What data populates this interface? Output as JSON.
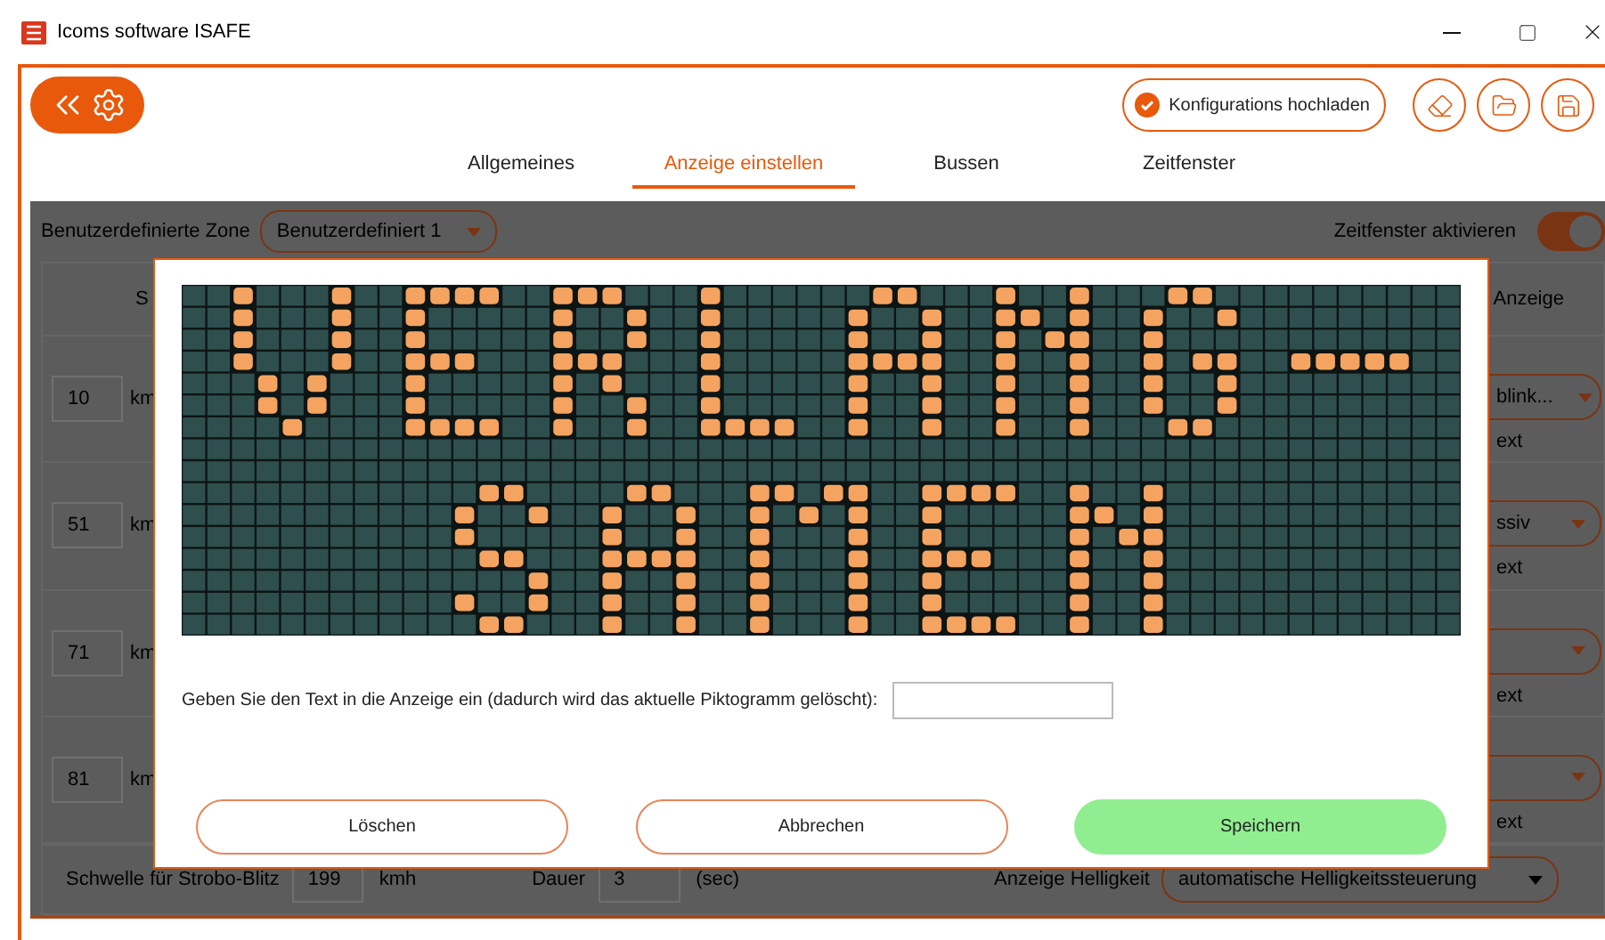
{
  "window": {
    "title": "Icoms software ISAFE"
  },
  "toolbar": {
    "upload_button": "Konfigurations hochladen"
  },
  "tabs": [
    {
      "label": "Allgemeines",
      "selected": false
    },
    {
      "label": "Anzeige einstellen",
      "selected": true
    },
    {
      "label": "Bussen",
      "selected": false
    },
    {
      "label": "Zeitfenster",
      "selected": false
    }
  ],
  "zone": {
    "label": "Benutzerdefinierte Zone",
    "value": "Benutzerdefiniert 1"
  },
  "time_window": {
    "label": "Zeitfenster aktivieren",
    "on": true
  },
  "table": {
    "column_1": "S",
    "column_2": "Anzeige",
    "rows": [
      {
        "speed": "10",
        "unit": "km",
        "display": "blink...",
        "note": "ext"
      },
      {
        "speed": "51",
        "unit": "km",
        "display": "ssiv",
        "note": "ext"
      },
      {
        "speed": "71",
        "unit": "km",
        "note": "ext"
      },
      {
        "speed": "81",
        "unit": "km",
        "note": "ext"
      }
    ]
  },
  "strobe": {
    "label": "Schwelle für Strobo-Blitz",
    "value": "199",
    "unit": "kmh",
    "duration_label": "Dauer",
    "duration": "3",
    "duration_unit": "(sec)",
    "brightness_label": "Anzeige Helligkeit",
    "brightness": "automatische Helligkeitssteuerung"
  },
  "dialog": {
    "matrix": {
      "rows": [
        {
          "lit": [
            false,
            false,
            true,
            false,
            false,
            false,
            true,
            false,
            false,
            true,
            true,
            true,
            true,
            false,
            false,
            true,
            true,
            true,
            false,
            false,
            false,
            true,
            false,
            false,
            false,
            false,
            false,
            false,
            true,
            true,
            false,
            false,
            false,
            true,
            false,
            false,
            true,
            false,
            false,
            false,
            true,
            true,
            false,
            false,
            false,
            false,
            false,
            false,
            false,
            false,
            false,
            false
          ]
        },
        {
          "lit": [
            false,
            false,
            true,
            false,
            false,
            false,
            true,
            false,
            false,
            true,
            false,
            false,
            false,
            false,
            false,
            true,
            false,
            false,
            true,
            false,
            false,
            true,
            false,
            false,
            false,
            false,
            false,
            true,
            false,
            false,
            true,
            false,
            false,
            true,
            true,
            false,
            true,
            false,
            false,
            true,
            false,
            false,
            true,
            false,
            false,
            false,
            false,
            false,
            false,
            false,
            false,
            false
          ]
        },
        {
          "lit": [
            false,
            false,
            true,
            false,
            false,
            false,
            true,
            false,
            false,
            true,
            false,
            false,
            false,
            false,
            false,
            true,
            false,
            false,
            true,
            false,
            false,
            true,
            false,
            false,
            false,
            false,
            false,
            true,
            false,
            false,
            true,
            false,
            false,
            true,
            false,
            true,
            true,
            false,
            false,
            true,
            false,
            false,
            false,
            false,
            false,
            false,
            false,
            false,
            false,
            false,
            false,
            false
          ]
        },
        {
          "lit": [
            false,
            false,
            true,
            false,
            false,
            false,
            true,
            false,
            false,
            true,
            true,
            true,
            false,
            false,
            false,
            true,
            true,
            true,
            false,
            false,
            false,
            true,
            false,
            false,
            false,
            false,
            false,
            true,
            true,
            true,
            true,
            false,
            false,
            true,
            false,
            false,
            true,
            false,
            false,
            true,
            false,
            true,
            true,
            false,
            false,
            true,
            true,
            true,
            true,
            true,
            false,
            false
          ]
        },
        {
          "lit": [
            false,
            false,
            false,
            true,
            false,
            true,
            false,
            false,
            false,
            true,
            false,
            false,
            false,
            false,
            false,
            true,
            false,
            true,
            false,
            false,
            false,
            true,
            false,
            false,
            false,
            false,
            false,
            true,
            false,
            false,
            true,
            false,
            false,
            true,
            false,
            false,
            true,
            false,
            false,
            true,
            false,
            false,
            true,
            false,
            false,
            false,
            false,
            false,
            false,
            false,
            false,
            false
          ]
        },
        {
          "lit": [
            false,
            false,
            false,
            true,
            false,
            true,
            false,
            false,
            false,
            true,
            false,
            false,
            false,
            false,
            false,
            true,
            false,
            false,
            true,
            false,
            false,
            true,
            false,
            false,
            false,
            false,
            false,
            true,
            false,
            false,
            true,
            false,
            false,
            true,
            false,
            false,
            true,
            false,
            false,
            true,
            false,
            false,
            true,
            false,
            false,
            false,
            false,
            false,
            false,
            false,
            false,
            false
          ]
        },
        {
          "lit": [
            false,
            false,
            false,
            false,
            true,
            false,
            false,
            false,
            false,
            true,
            true,
            true,
            true,
            false,
            false,
            true,
            false,
            false,
            true,
            false,
            false,
            true,
            true,
            true,
            true,
            false,
            false,
            true,
            false,
            false,
            true,
            false,
            false,
            true,
            false,
            false,
            true,
            false,
            false,
            false,
            true,
            true,
            false,
            false,
            false,
            false,
            false,
            false,
            false,
            false,
            false,
            false
          ]
        },
        {
          "lit": [
            false,
            false,
            false,
            false,
            false,
            false,
            false,
            false,
            false,
            false,
            false,
            false,
            false,
            false,
            false,
            false,
            false,
            false,
            false,
            false,
            false,
            false,
            false,
            false,
            false,
            false,
            false,
            false,
            false,
            false,
            false,
            false,
            false,
            false,
            false,
            false,
            false,
            false,
            false,
            false,
            false,
            false,
            false,
            false,
            false,
            false,
            false,
            false,
            false,
            false,
            false,
            false
          ]
        },
        {
          "lit": [
            false,
            false,
            false,
            false,
            false,
            false,
            false,
            false,
            false,
            false,
            false,
            false,
            false,
            false,
            false,
            false,
            false,
            false,
            false,
            false,
            false,
            false,
            false,
            false,
            false,
            false,
            false,
            false,
            false,
            false,
            false,
            false,
            false,
            false,
            false,
            false,
            false,
            false,
            false,
            false,
            false,
            false,
            false,
            false,
            false,
            false,
            false,
            false,
            false,
            false,
            false,
            false
          ]
        },
        {
          "lit": [
            false,
            false,
            false,
            false,
            false,
            false,
            false,
            false,
            false,
            false,
            false,
            false,
            true,
            true,
            false,
            false,
            false,
            false,
            true,
            true,
            false,
            false,
            false,
            true,
            true,
            false,
            true,
            true,
            false,
            false,
            true,
            true,
            true,
            true,
            false,
            false,
            true,
            false,
            false,
            true,
            false,
            false,
            false,
            false,
            false,
            false,
            false,
            false,
            false,
            false,
            false,
            false
          ]
        },
        {
          "lit": [
            false,
            false,
            false,
            false,
            false,
            false,
            false,
            false,
            false,
            false,
            false,
            true,
            false,
            false,
            true,
            false,
            false,
            true,
            false,
            false,
            true,
            false,
            false,
            true,
            false,
            true,
            false,
            true,
            false,
            false,
            true,
            false,
            false,
            false,
            false,
            false,
            true,
            true,
            false,
            true,
            false,
            false,
            false,
            false,
            false,
            false,
            false,
            false,
            false,
            false,
            false,
            false
          ]
        },
        {
          "lit": [
            false,
            false,
            false,
            false,
            false,
            false,
            false,
            false,
            false,
            false,
            false,
            true,
            false,
            false,
            false,
            false,
            false,
            true,
            false,
            false,
            true,
            false,
            false,
            true,
            false,
            false,
            false,
            true,
            false,
            false,
            true,
            false,
            false,
            false,
            false,
            false,
            true,
            false,
            true,
            true,
            false,
            false,
            false,
            false,
            false,
            false,
            false,
            false,
            false,
            false,
            false,
            false
          ]
        },
        {
          "lit": [
            false,
            false,
            false,
            false,
            false,
            false,
            false,
            false,
            false,
            false,
            false,
            false,
            true,
            true,
            false,
            false,
            false,
            true,
            true,
            true,
            true,
            false,
            false,
            true,
            false,
            false,
            false,
            true,
            false,
            false,
            true,
            true,
            true,
            false,
            false,
            false,
            true,
            false,
            false,
            true,
            false,
            false,
            false,
            false,
            false,
            false,
            false,
            false,
            false,
            false,
            false,
            false
          ]
        },
        {
          "lit": [
            false,
            false,
            false,
            false,
            false,
            false,
            false,
            false,
            false,
            false,
            false,
            false,
            false,
            false,
            true,
            false,
            false,
            true,
            false,
            false,
            true,
            false,
            false,
            true,
            false,
            false,
            false,
            true,
            false,
            false,
            true,
            false,
            false,
            false,
            false,
            false,
            true,
            false,
            false,
            true,
            false,
            false,
            false,
            false,
            false,
            false,
            false,
            false,
            false,
            false,
            false,
            false
          ]
        },
        {
          "lit": [
            false,
            false,
            false,
            false,
            false,
            false,
            false,
            false,
            false,
            false,
            false,
            true,
            false,
            false,
            true,
            false,
            false,
            true,
            false,
            false,
            true,
            false,
            false,
            true,
            false,
            false,
            false,
            true,
            false,
            false,
            true,
            false,
            false,
            false,
            false,
            false,
            true,
            false,
            false,
            true,
            false,
            false,
            false,
            false,
            false,
            false,
            false,
            false,
            false,
            false,
            false,
            false
          ]
        },
        {
          "lit": [
            false,
            false,
            false,
            false,
            false,
            false,
            false,
            false,
            false,
            false,
            false,
            false,
            true,
            true,
            false,
            false,
            false,
            true,
            false,
            false,
            true,
            false,
            false,
            true,
            false,
            false,
            false,
            true,
            false,
            false,
            true,
            true,
            true,
            true,
            false,
            false,
            true,
            false,
            false,
            true,
            false,
            false,
            false,
            false,
            false,
            false,
            false,
            false,
            false,
            false,
            false,
            false
          ]
        }
      ]
    },
    "prompt": "Geben Sie den Text in die Anzeige ein (dadurch wird das aktuelle Piktogramm gelöscht):",
    "buttons": [
      {
        "label": "Löschen",
        "kind": "outline"
      },
      {
        "label": "Abbrechen",
        "kind": "outline"
      },
      {
        "label": "Speichern",
        "kind": "primary"
      }
    ]
  }
}
